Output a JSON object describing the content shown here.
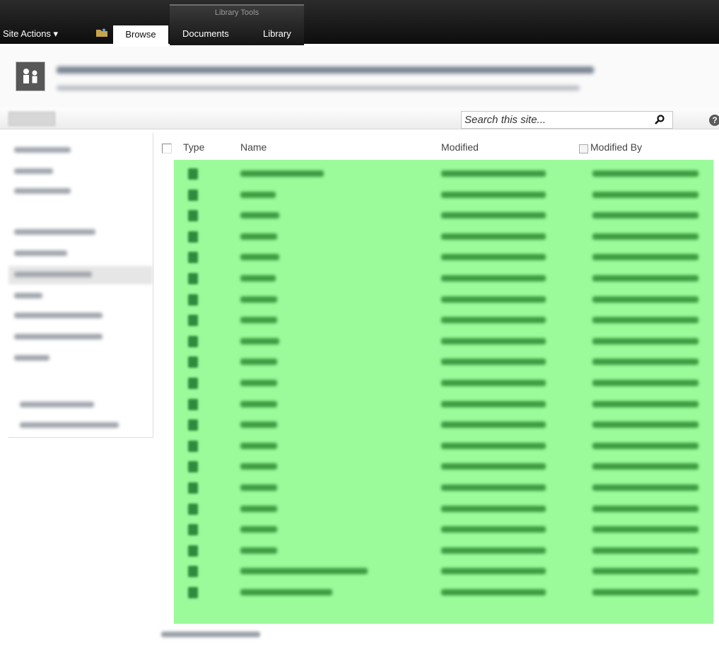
{
  "ribbon": {
    "contextual_group": "Library Tools",
    "site_actions": "Site Actions ▾",
    "tabs": [
      "Browse",
      "Documents",
      "Library"
    ]
  },
  "search": {
    "placeholder": "Search this site..."
  },
  "help": {
    "glyph": "?"
  },
  "list": {
    "columns": [
      "Type",
      "Name",
      "Modified",
      "Modified By"
    ],
    "row_count": 21,
    "highlight_color": "#9bfb9a"
  }
}
